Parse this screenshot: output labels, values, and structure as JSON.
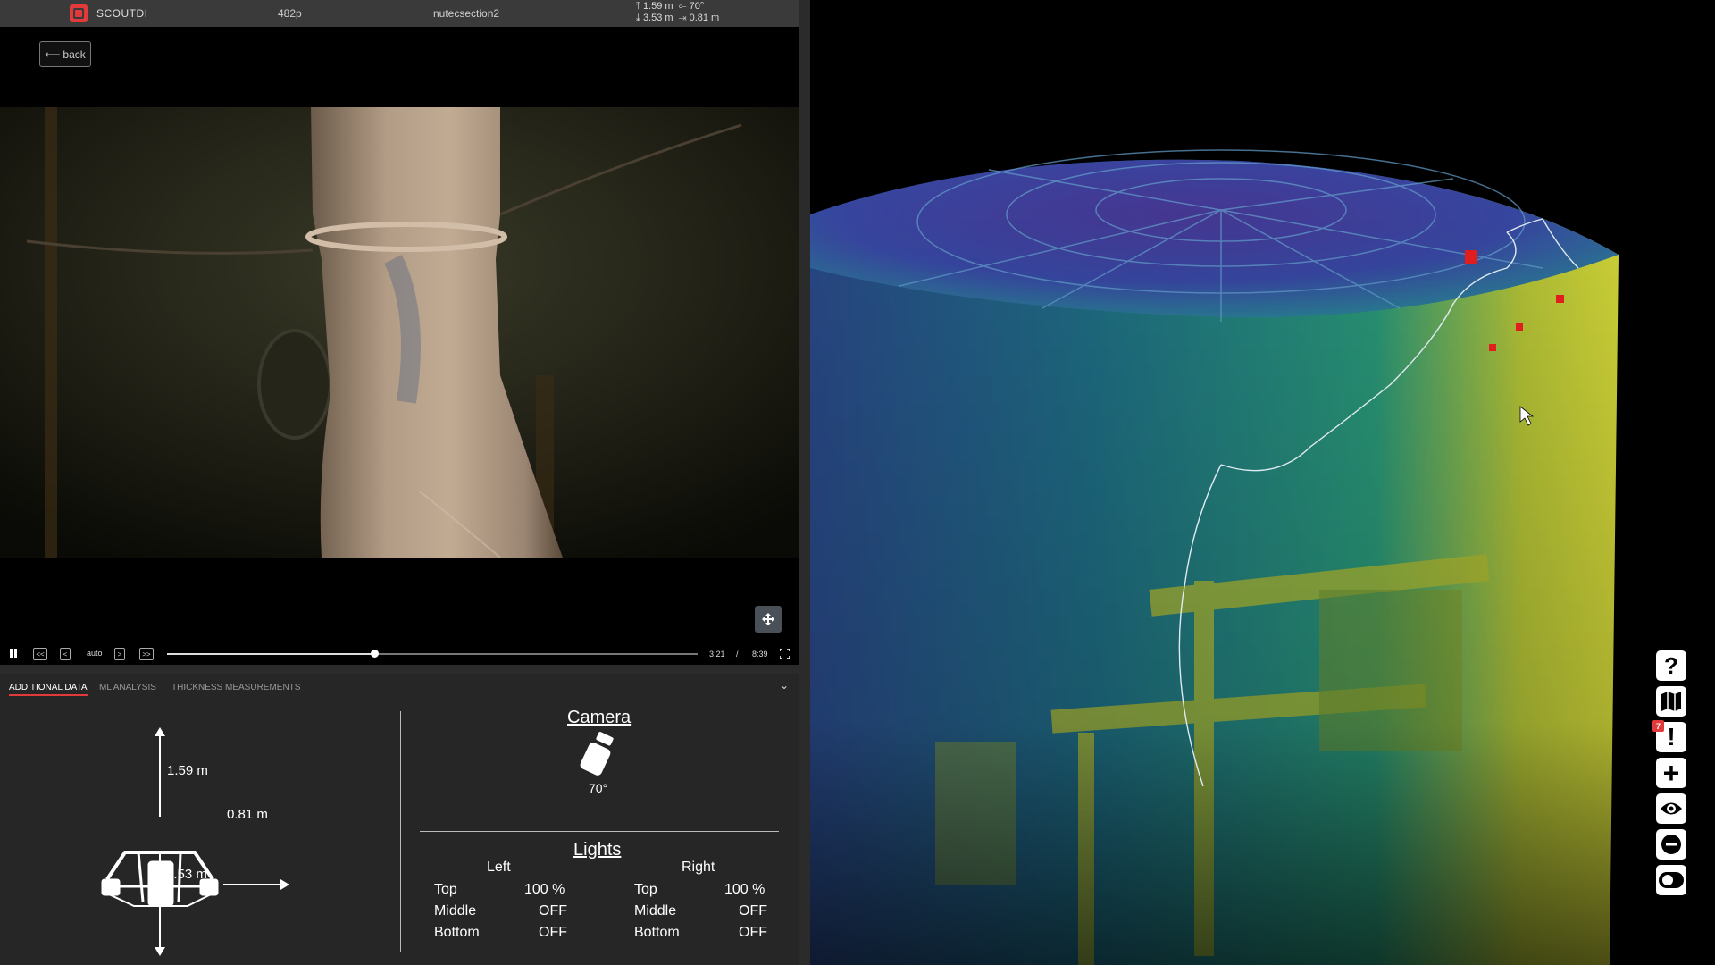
{
  "topbar": {
    "brand": "SCOUTDI",
    "quality": "482p",
    "section": "nutecsection2",
    "up": "1.59 m",
    "down": "3.53 m",
    "angle": "70°",
    "side": "0.81 m"
  },
  "back_label": "back",
  "player": {
    "speed": "auto",
    "current_time": "3:21",
    "separator": "/",
    "total_time": "8:39",
    "progress": 0.39
  },
  "tabs": [
    {
      "label": "ADDITIONAL DATA",
      "active": true
    },
    {
      "label": "ML ANALYSIS",
      "active": false
    },
    {
      "label": "THICKNESS MEASUREMENTS",
      "active": false
    }
  ],
  "distances": {
    "up": "1.59 m",
    "side": "0.81 m",
    "down": "3.53 m"
  },
  "camera": {
    "title": "Camera",
    "angle": "70°"
  },
  "lights": {
    "title": "Lights",
    "left_header": "Left",
    "right_header": "Right",
    "left": [
      {
        "name": "Top",
        "value": "100 %"
      },
      {
        "name": "Middle",
        "value": "OFF"
      },
      {
        "name": "Bottom",
        "value": "OFF"
      }
    ],
    "right": [
      {
        "name": "Top",
        "value": "100 %"
      },
      {
        "name": "Middle",
        "value": "OFF"
      },
      {
        "name": "Bottom",
        "value": "OFF"
      }
    ]
  },
  "toolbar": {
    "help_icon": "?",
    "map_icon": "map-icon",
    "alert_icon": "!",
    "alert_count": "7",
    "add_icon": "+",
    "eye_icon": "eye-icon",
    "minus_icon": "minus-icon",
    "toggle_icon": "toggle-icon"
  },
  "colors": {
    "accent": "#e23a3a",
    "panel": "#262626",
    "topbar": "#3a3a3a"
  }
}
